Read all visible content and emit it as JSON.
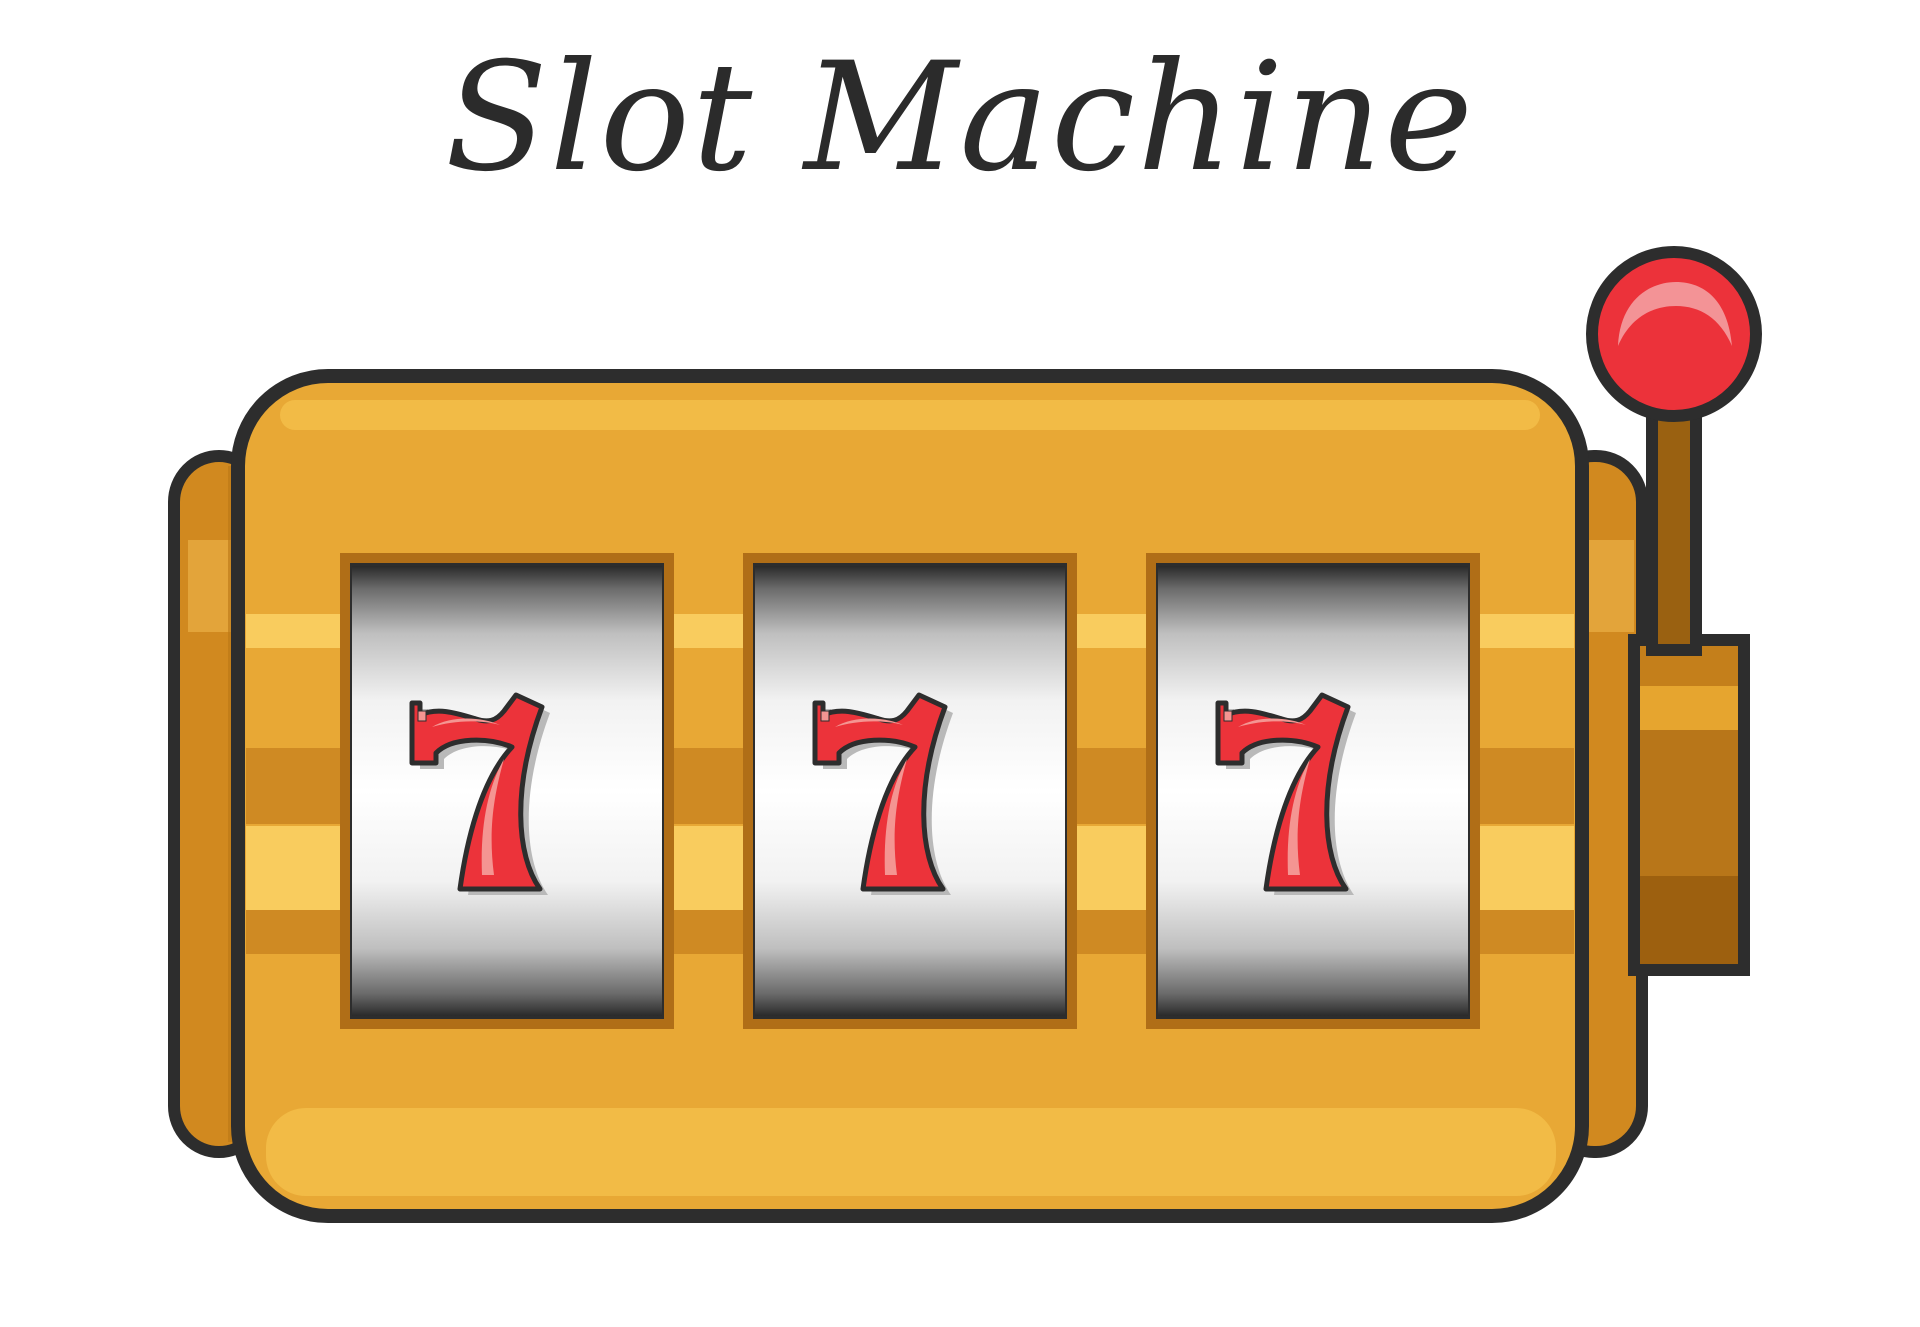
{
  "game": {
    "title": "Slot Machine",
    "reels": [
      {
        "symbol": "7"
      },
      {
        "symbol": "7"
      },
      {
        "symbol": "7"
      }
    ],
    "lever": {
      "state": "up"
    }
  },
  "colors": {
    "outline": "#2d2d2d",
    "gold_body": "#e8a835",
    "gold_light": "#f2bb46",
    "gold_band_light": "#f9cc5e",
    "gold_band_dark": "#cf8a23",
    "gold_side": "#d1891f",
    "gold_side_inner": "#e3a43a",
    "reel_frame": "#b06e17",
    "seven_red": "#ec333a",
    "seven_highlight": "#f49592",
    "knob_red": "#ec323a",
    "knob_highlight": "#f39396",
    "lever_rod": "#9a6111",
    "lever_box": "#b87619",
    "lever_box_band": "#e6a52f",
    "lever_box_dark": "#9d600f"
  }
}
